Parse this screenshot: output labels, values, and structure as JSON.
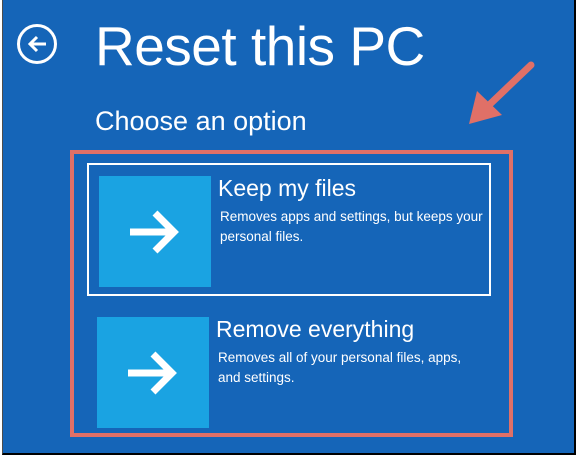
{
  "header": {
    "back_icon": "arrow-left-circle-icon",
    "title": "Reset this PC",
    "subtitle": "Choose an option"
  },
  "options": [
    {
      "title": "Keep my files",
      "description": "Removes apps and settings, but keeps your personal files.",
      "icon": "arrow-right-icon",
      "selected": true
    },
    {
      "title": "Remove everything",
      "description": "Removes all of your personal files, apps, and settings.",
      "icon": "arrow-right-icon",
      "selected": false
    }
  ],
  "colors": {
    "background": "#1565b8",
    "tile": "#1aa3e2",
    "annotation": "#e07067",
    "text": "#ffffff"
  }
}
